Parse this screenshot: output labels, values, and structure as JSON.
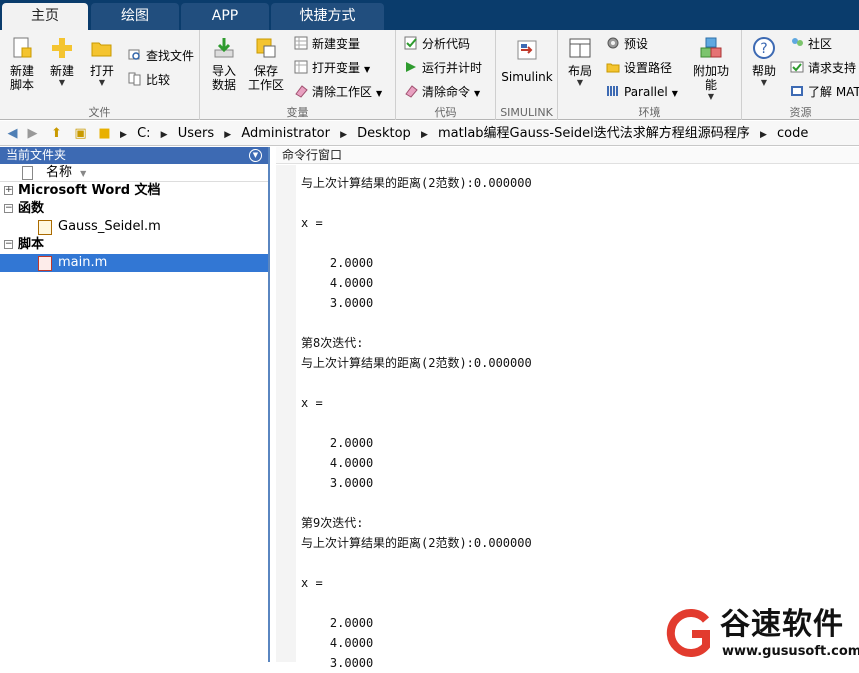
{
  "tabs": [
    "主页",
    "绘图",
    "APP",
    "快捷方式"
  ],
  "ribbon": {
    "file": {
      "label": "文件",
      "new_script": "新建\n脚本",
      "new": "新建",
      "open": "打开",
      "find_files": "查找文件",
      "compare": "比较"
    },
    "variable": {
      "label": "变量",
      "import": "导入\n数据",
      "save_ws": "保存\n工作区",
      "new_var": "新建变量",
      "open_var": "打开变量",
      "clear_ws": "清除工作区"
    },
    "code": {
      "label": "代码",
      "analyze": "分析代码",
      "run_time": "运行并计时",
      "clear_cmd": "清除命令"
    },
    "simulink": {
      "label": "SIMULINK",
      "simulink": "Simulink"
    },
    "env": {
      "label": "环境",
      "layout": "布局",
      "prefs": "预设",
      "set_path": "设置路径",
      "parallel": "Parallel",
      "addons": "附加功能"
    },
    "resources": {
      "label": "资源",
      "help": "帮助",
      "community": "社区",
      "support": "请求支持",
      "learn": "了解 MAT"
    }
  },
  "address": [
    "C:",
    "Users",
    "Administrator",
    "Desktop",
    "matlab编程Gauss-Seidel迭代法求解方程组源码程序",
    "code"
  ],
  "left_panel": {
    "title": "当前文件夹",
    "col_name": "名称",
    "groups": [
      {
        "name": "Microsoft Word 文档",
        "sign": "+"
      },
      {
        "name": "函数",
        "sign": "−",
        "files": [
          "Gauss_Seidel.m"
        ]
      },
      {
        "name": "脚本",
        "sign": "−",
        "files": [
          "main.m"
        ]
      }
    ]
  },
  "cmd": {
    "title": "命令行窗口",
    "text": "与上次计算结果的距离(2范数):0.000000\n\nx =\n\n    2.0000\n    4.0000\n    3.0000\n\n第8次迭代:\n与上次计算结果的距离(2范数):0.000000\n\nx =\n\n    2.0000\n    4.0000\n    3.0000\n\n第9次迭代:\n与上次计算结果的距离(2范数):0.000000\n\nx =\n\n    2.0000\n    4.0000\n    3.0000"
  },
  "watermark": {
    "brand": "谷速软件",
    "url": "www.gususoft.com"
  },
  "colors": {
    "tabbar": "#0a3c6c",
    "selection": "#3277d4",
    "watermark_red": "#e23b2e"
  }
}
